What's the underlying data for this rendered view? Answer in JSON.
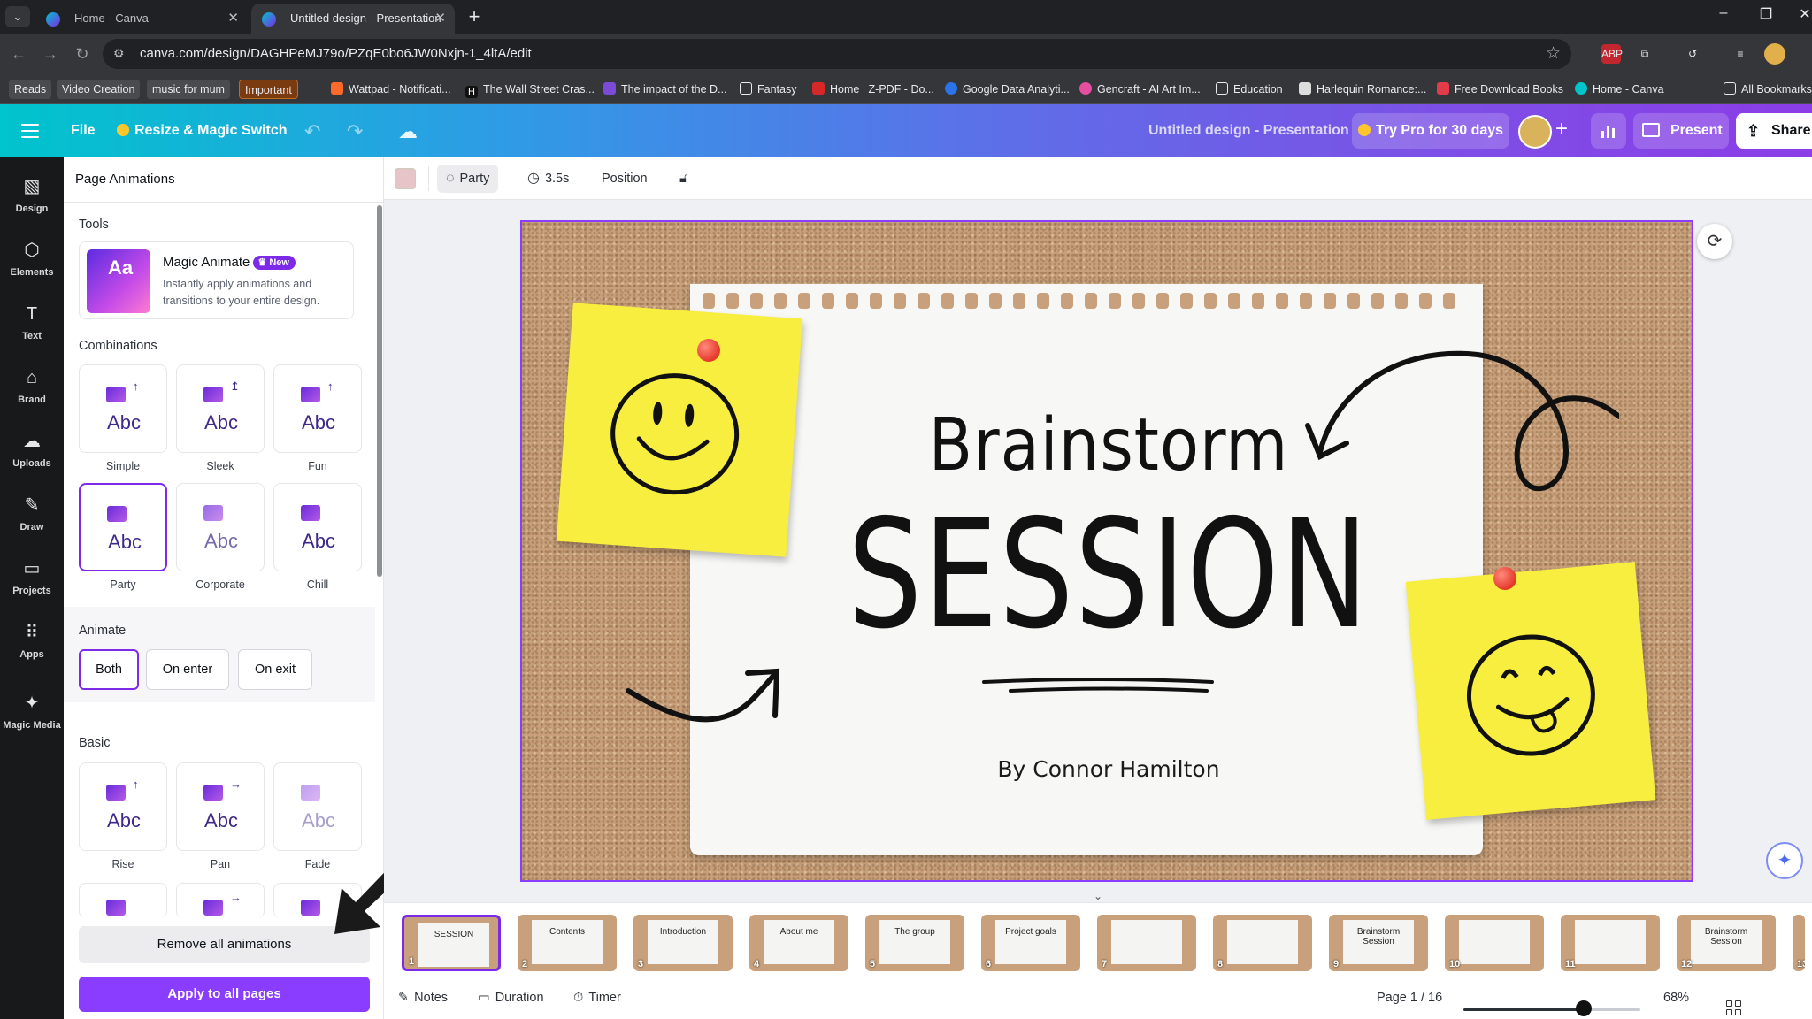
{
  "browser": {
    "tabs": [
      {
        "title": "Home - Canva",
        "active": false
      },
      {
        "title": "Untitled design - Presentation",
        "active": true
      }
    ],
    "url": "canva.com/design/DAGHPeMJ79o/PZqE0bo6JW0Nxjn-1_4ltA/edit",
    "bookmarks": [
      {
        "label": "Reads",
        "style": "pill"
      },
      {
        "label": "Video Creation",
        "style": "pill"
      },
      {
        "label": "music for mum",
        "style": "pill"
      },
      {
        "label": "Important",
        "style": "important"
      },
      {
        "label": "Wattpad - Notificati...",
        "icon": "wattpad-icon"
      },
      {
        "label": "The Wall Street Cras...",
        "icon": "h-icon"
      },
      {
        "label": "The impact of the D...",
        "icon": "bookmark-icon"
      },
      {
        "label": "Fantasy",
        "icon": "folder-icon"
      },
      {
        "label": "Home | Z-PDF - Do...",
        "icon": "z-icon"
      },
      {
        "label": "Google Data Analyti...",
        "icon": "coursera-icon"
      },
      {
        "label": "Gencraft - AI Art Im...",
        "icon": "gencraft-icon"
      },
      {
        "label": "Education",
        "icon": "folder-icon"
      },
      {
        "label": "Harlequin Romance:...",
        "icon": "harlequin-icon"
      },
      {
        "label": "Free Download Books",
        "icon": "book-icon"
      },
      {
        "label": "Home - Canva",
        "icon": "canva-icon"
      },
      {
        "label": "All Bookmarks",
        "icon": "folder-icon"
      }
    ]
  },
  "header": {
    "file": "File",
    "resize": "Resize & Magic Switch",
    "title": "Untitled design - Presentation",
    "try_pro": "Try Pro for 30 days",
    "present": "Present",
    "share": "Share"
  },
  "rail": [
    {
      "label": "Design",
      "icon": "design-icon",
      "glyph": "▧"
    },
    {
      "label": "Elements",
      "icon": "elements-icon",
      "glyph": "⬡"
    },
    {
      "label": "Text",
      "icon": "text-icon",
      "glyph": "T"
    },
    {
      "label": "Brand",
      "icon": "brand-icon",
      "glyph": "⌂"
    },
    {
      "label": "Uploads",
      "icon": "upload-cloud-icon",
      "glyph": "☁"
    },
    {
      "label": "Draw",
      "icon": "draw-icon",
      "glyph": "✎"
    },
    {
      "label": "Projects",
      "icon": "folder-icon",
      "glyph": "▭"
    },
    {
      "label": "Apps",
      "icon": "apps-grid-icon",
      "glyph": "⠿"
    },
    {
      "label": "Magic Media",
      "icon": "magic-media-icon",
      "glyph": "✦"
    }
  ],
  "panel": {
    "title": "Page Animations",
    "tools_heading": "Tools",
    "magic_animate": {
      "title": "Magic Animate",
      "badge": "New",
      "description": "Instantly apply animations and transitions to your entire design.",
      "thumb_text": "Aa"
    },
    "combinations_heading": "Combinations",
    "combinations": [
      {
        "label": "Simple"
      },
      {
        "label": "Sleek"
      },
      {
        "label": "Fun"
      },
      {
        "label": "Party",
        "selected": true
      },
      {
        "label": "Corporate"
      },
      {
        "label": "Chill"
      }
    ],
    "animate_heading": "Animate",
    "animate_options": [
      {
        "label": "Both",
        "selected": true
      },
      {
        "label": "On enter"
      },
      {
        "label": "On exit"
      }
    ],
    "basic_heading": "Basic",
    "basic": [
      {
        "label": "Rise"
      },
      {
        "label": "Pan"
      },
      {
        "label": "Fade"
      }
    ],
    "tile_text": "Abc",
    "remove_all": "Remove all animations",
    "apply_all": "Apply to all pages"
  },
  "toolbar": {
    "swatch_color": "#e6c4c8",
    "animation": "Party",
    "duration": "3.5s",
    "position": "Position"
  },
  "slide": {
    "title_top": "Brainstorm",
    "title_main": "SESSION",
    "byline": "By Connor Hamilton"
  },
  "filmstrip": [
    {
      "num": "1",
      "text": "SESSION",
      "selected": true
    },
    {
      "num": "2",
      "text": "Contents"
    },
    {
      "num": "3",
      "text": "Introduction"
    },
    {
      "num": "4",
      "text": "About me"
    },
    {
      "num": "5",
      "text": "The group"
    },
    {
      "num": "6",
      "text": "Project goals"
    },
    {
      "num": "7",
      "text": ""
    },
    {
      "num": "8",
      "text": ""
    },
    {
      "num": "9",
      "text": "Brainstorm Session"
    },
    {
      "num": "10",
      "text": ""
    },
    {
      "num": "11",
      "text": ""
    },
    {
      "num": "12",
      "text": "Brainstorm Session"
    },
    {
      "num": "13",
      "text": ""
    }
  ],
  "footer": {
    "notes": "Notes",
    "duration": "Duration",
    "timer": "Timer",
    "page": "Page 1 / 16",
    "zoom": "68%",
    "zoom_level": 0.68
  },
  "colors": {
    "accent": "#7d2ae8",
    "apply_button": "#8b3dff",
    "sticky_note": "#f7ee3f",
    "pin": "#e5372a"
  }
}
